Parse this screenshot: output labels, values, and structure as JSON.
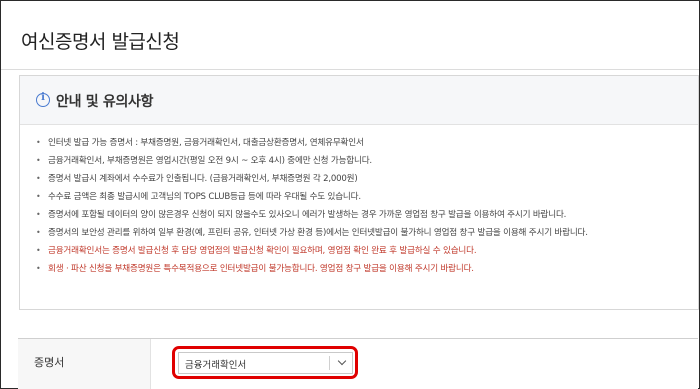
{
  "page": {
    "title": "여신증명서 발급신청"
  },
  "notice": {
    "title": "안내 및 유의사항",
    "items": [
      {
        "text": "인터넷 발급 가능 증명서 : 부채증명원, 금융거래확인서, 대출금상환증명서, 연체유무확인서",
        "style": "normal"
      },
      {
        "text": "금융거래확인서, 부채증명원은 영업시간(평일 오전 9시 ~ 오후 4시) 중에만 신청 가능합니다.",
        "style": "normal"
      },
      {
        "text": "증명서 발급시 계좌에서 수수료가 인출됩니다. (금융거래확인서, 부채증명원 각 2,000원)",
        "style": "normal"
      },
      {
        "text": "수수료 금액은 최종 발급시에 고객님의 TOPS CLUB등급 등에 따라 우대될 수도 있습니다.",
        "style": "normal"
      },
      {
        "text": "증명서에 포함될 데이터의 양이 많은경우 신청이 되지 않을수도 있사오니 에러가 발생하는 경우 가까운 영업점 창구 발급을 이용하여 주시기 바랍니다.",
        "style": "normal"
      },
      {
        "text": "증명서의 보안성 관리를 위하여 일부 환경(예, 프린터 공유, 인터넷 가상 환경 등)에서는 인터넷발급이 불가하니 영업점 창구 발급을 이용해 주시기 바랍니다.",
        "style": "normal"
      },
      {
        "text": "금융거래확인서는 증명서 발급신청 후 담당 영업점의 발급신청 확인이 필요하며, 영업점 확인 완료 후 발급하실 수 있습니다.",
        "style": "red"
      },
      {
        "text": "회생 · 파산 신청을 부채증명원은 특수목적용으로 인터넷발급이 불가능합니다. 영업점 창구 발급을 이용해 주시기 바랍니다.",
        "style": "red"
      }
    ]
  },
  "form": {
    "certificate_label": "증명서",
    "certificate_selected": "금융거래확인서"
  },
  "colors": {
    "highlight": "#e00000",
    "notice_red": "#c0392b",
    "info_blue": "#4a7bd0"
  }
}
